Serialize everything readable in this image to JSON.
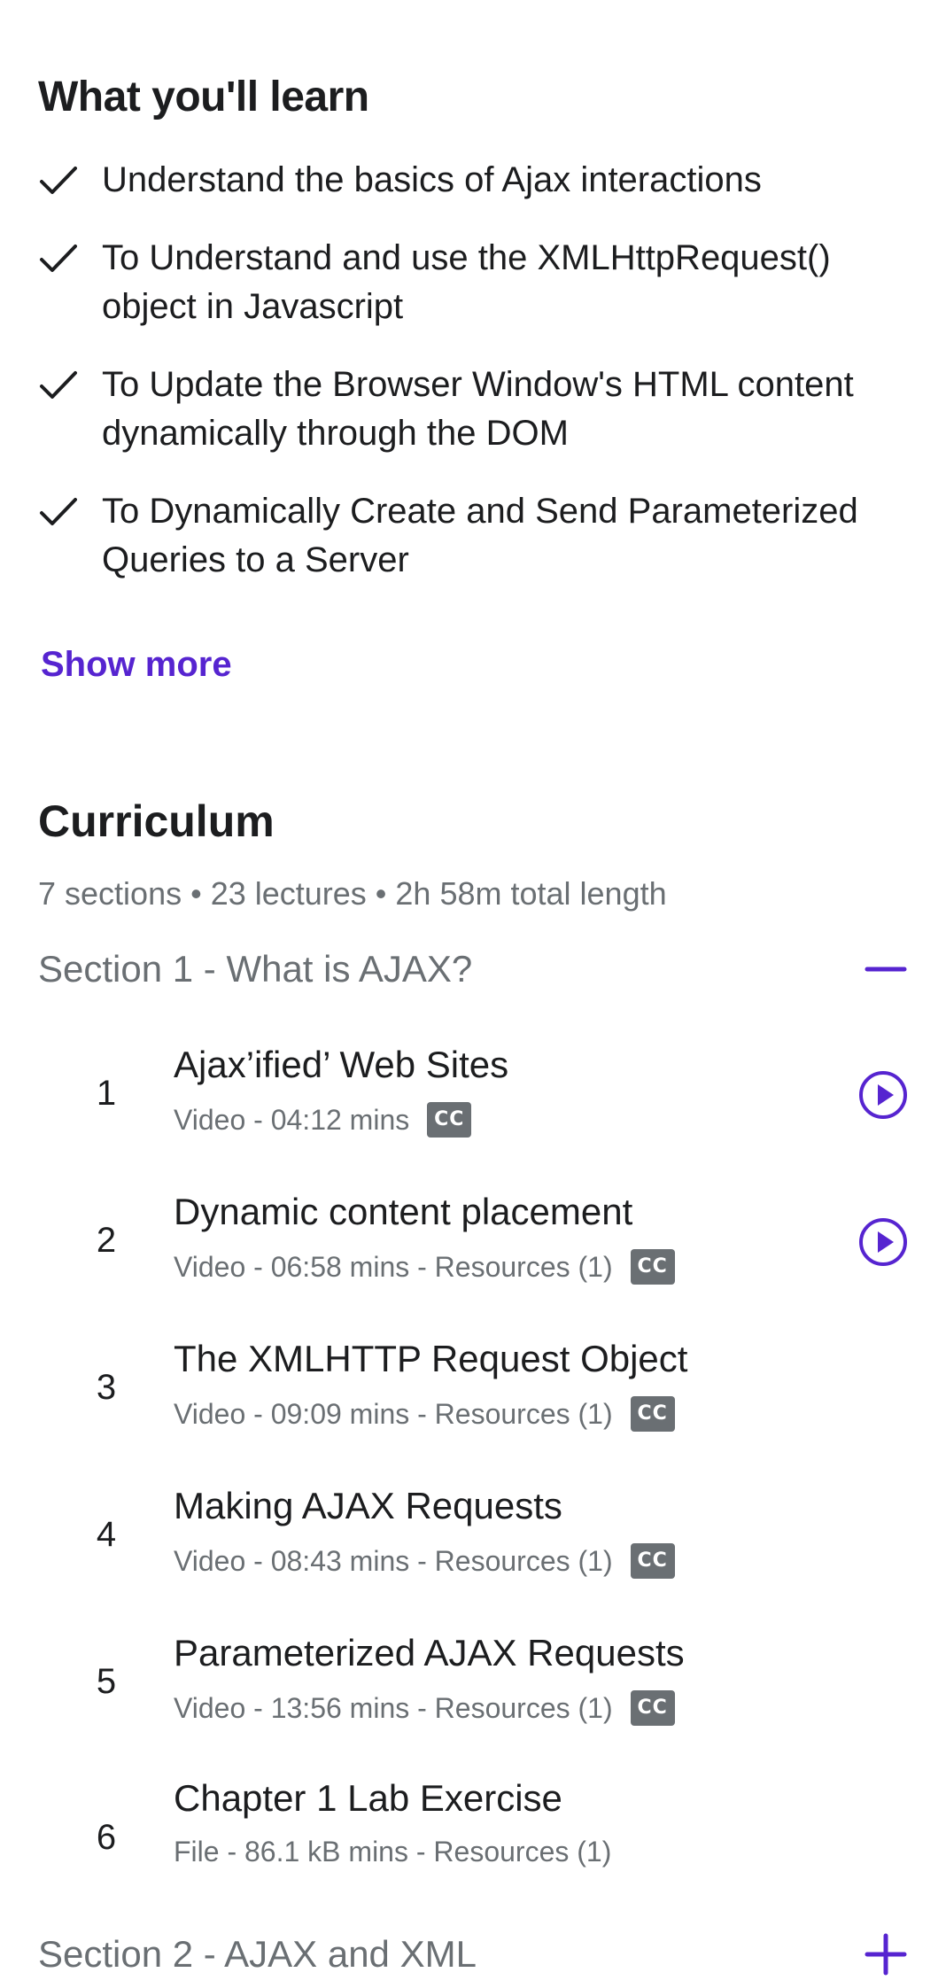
{
  "learn": {
    "title": "What you'll learn",
    "items": [
      "Understand the basics of Ajax interactions",
      "To Understand and use the XMLHttpRequest() object in Javascript",
      "To Update the Browser Window's HTML content dynamically through the DOM",
      "To Dynamically Create and Send Parameterized Queries to a Server"
    ],
    "show_more": "Show more"
  },
  "curriculum": {
    "title": "Curriculum",
    "meta": "7 sections • 23 lectures • 2h 58m total length",
    "sections": [
      {
        "title": "Section 1 - What is AJAX?",
        "expanded": true,
        "lectures": [
          {
            "num": "1",
            "title": "Ajax’ified’ Web Sites",
            "meta": "Video - 04:12 mins",
            "cc": true,
            "preview": true
          },
          {
            "num": "2",
            "title": "Dynamic content placement",
            "meta": "Video - 06:58 mins - Resources (1)",
            "cc": true,
            "preview": true
          },
          {
            "num": "3",
            "title": "The XMLHTTP Request Object",
            "meta": "Video - 09:09 mins - Resources (1)",
            "cc": true,
            "preview": false
          },
          {
            "num": "4",
            "title": "Making AJAX Requests",
            "meta": "Video - 08:43 mins - Resources (1)",
            "cc": true,
            "preview": false
          },
          {
            "num": "5",
            "title": "Parameterized AJAX Requests",
            "meta": "Video - 13:56 mins - Resources (1)",
            "cc": true,
            "preview": false
          },
          {
            "num": "6",
            "title": "Chapter 1 Lab Exercise",
            "meta": "File - 86.1 kB mins - Resources (1)",
            "cc": false,
            "preview": false
          }
        ]
      },
      {
        "title": "Section 2 - AJAX and XML",
        "expanded": false
      }
    ],
    "cc_label": "CC"
  },
  "colors": {
    "accent": "#5624d0",
    "text": "#1c1d1f",
    "muted": "#6a6f73"
  },
  "icons": {
    "check": "check-icon",
    "play": "play-circle-icon",
    "collapse": "minus-icon",
    "expand": "plus-icon"
  }
}
